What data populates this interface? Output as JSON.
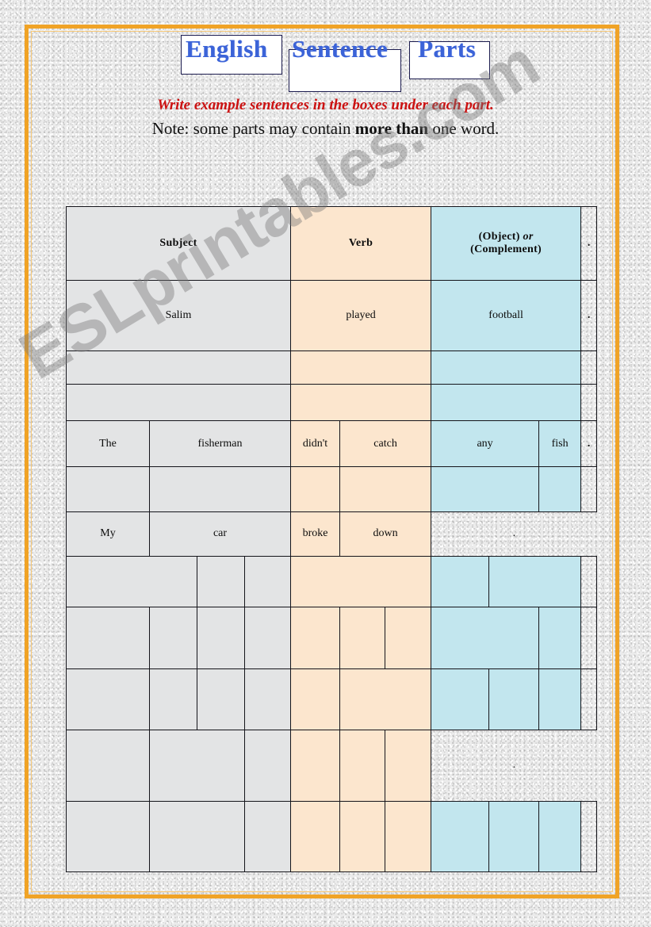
{
  "title": {
    "words": [
      {
        "text": "English",
        "box": true
      },
      {
        "text": "Sentence",
        "box": true
      },
      {
        "text": "Parts",
        "box": true
      }
    ],
    "color": "#3b63d8"
  },
  "instructions": {
    "line1": "Write example sentences in the boxes under each part.",
    "line1_color": "#cc1111",
    "line2_prefix": "Note: some parts may contain ",
    "line2_bold": "more than",
    "line2_suffix": " one word."
  },
  "colors": {
    "frame_outer": "#f0a326",
    "frame_inner": "#f6c878",
    "subject_fill": "#e3e4e5",
    "verb_fill": "#fce6ce",
    "object_fill": "#c2e6ee",
    "grid_line": "#14141a",
    "title_blue": "#3b63d8",
    "instruction_red": "#cc1111"
  },
  "table": {
    "headers": {
      "subject": "Subject",
      "verb": "Verb",
      "object_line1_a": "(Object) ",
      "object_line1_b": "or",
      "object_line2": "(Complement)",
      "period": "."
    },
    "rows": [
      {
        "name": "example-salim",
        "subject": [
          "Salim"
        ],
        "verb": [
          "played"
        ],
        "object": [
          "football"
        ],
        "period": "."
      },
      {
        "name": "blank-row-1",
        "subject": [
          ""
        ],
        "verb": [
          ""
        ],
        "object": [
          ""
        ],
        "period": ""
      },
      {
        "name": "blank-row-2",
        "subject": [
          ""
        ],
        "verb": [
          ""
        ],
        "object": [
          ""
        ],
        "period": ""
      },
      {
        "name": "example-fisherman",
        "subject": [
          "The",
          "fisherman"
        ],
        "verb": [
          "didn't",
          "catch"
        ],
        "object": [
          "any",
          "fish"
        ],
        "period": "."
      },
      {
        "name": "blank-row-3",
        "subject": [
          "",
          ""
        ],
        "verb": [
          "",
          ""
        ],
        "object": [
          "",
          ""
        ],
        "period": ""
      },
      {
        "name": "example-my-car",
        "subject": [
          "My",
          "car"
        ],
        "verb": [
          "broke",
          "down"
        ],
        "object": [
          "."
        ],
        "period": ""
      },
      {
        "name": "blank-row-4",
        "subject": [
          "",
          "",
          ""
        ],
        "verb": [
          ""
        ],
        "object": [
          "",
          ""
        ],
        "period": ""
      },
      {
        "name": "blank-row-5",
        "subject": [
          "",
          "",
          "",
          ""
        ],
        "verb": [
          "",
          "",
          ""
        ],
        "object": [
          "",
          ""
        ],
        "period": ""
      },
      {
        "name": "blank-row-6",
        "subject": [
          "",
          "",
          "",
          ""
        ],
        "verb": [
          "",
          ""
        ],
        "object": [
          "",
          "",
          ""
        ],
        "period": ""
      },
      {
        "name": "blank-row-7",
        "subject": [
          "",
          "",
          ""
        ],
        "verb": [
          "",
          "",
          ""
        ],
        "object": [
          "."
        ],
        "period": ""
      },
      {
        "name": "blank-row-8",
        "subject": [
          "",
          "",
          ""
        ],
        "verb": [
          "",
          "",
          ""
        ],
        "object": [
          "",
          "",
          ""
        ],
        "period": ""
      }
    ]
  },
  "watermark": {
    "text": "ESLprintables.com"
  }
}
